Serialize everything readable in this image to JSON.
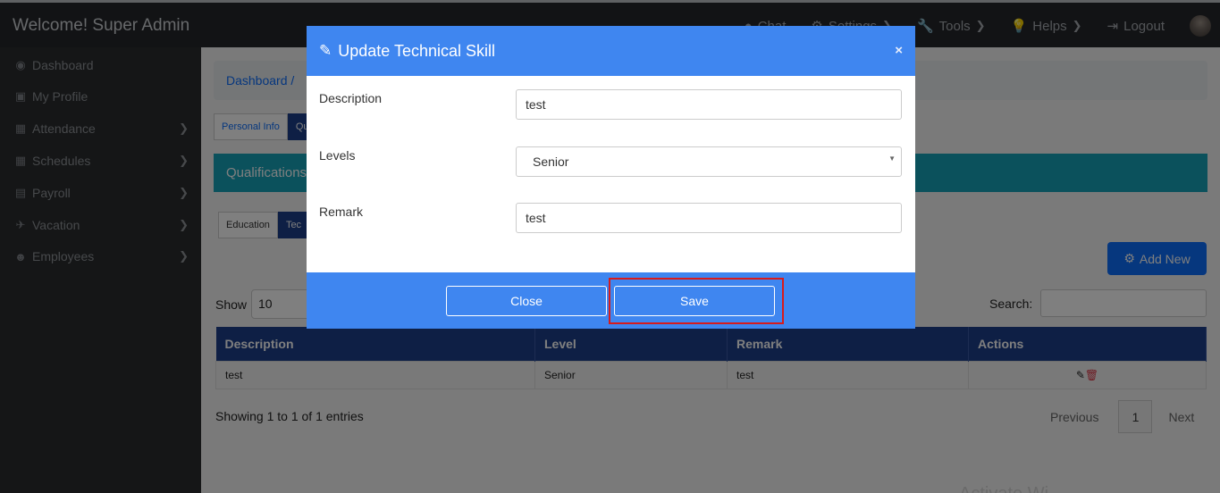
{
  "header": {
    "brand": "Welcome! Super Admin",
    "nav": [
      {
        "label": "Chat",
        "icon": "chat-icon"
      },
      {
        "label": "Settings",
        "icon": "gear-icon"
      },
      {
        "label": "Tools",
        "icon": "wrench-icon"
      },
      {
        "label": "Helps",
        "icon": "lightbulb-icon"
      },
      {
        "label": "Logout",
        "icon": "logout-icon"
      }
    ]
  },
  "sidebar": {
    "items": [
      {
        "label": "Dashboard",
        "icon": "dashboard-icon"
      },
      {
        "label": "My Profile",
        "icon": "profile-icon"
      },
      {
        "label": "Attendance",
        "icon": "calendar-icon"
      },
      {
        "label": "Schedules",
        "icon": "schedule-icon"
      },
      {
        "label": "Payroll",
        "icon": "payroll-icon"
      },
      {
        "label": "Vacation",
        "icon": "plane-icon"
      },
      {
        "label": "Employees",
        "icon": "users-icon"
      }
    ]
  },
  "page": {
    "breadcrumb": "Dashboard  /",
    "tabs": [
      "Personal Info",
      "Qu"
    ],
    "qual_title": "Qualifications",
    "subtabs": [
      "Education",
      "Tec"
    ],
    "add_new": "Add New",
    "show_label": "Show",
    "show_value": "10",
    "search_label": "Search:",
    "table": {
      "headers": [
        "Description",
        "Level",
        "Remark",
        "Actions"
      ],
      "rows": [
        [
          "test",
          "Senior",
          "test"
        ]
      ]
    },
    "info": "Showing 1 to 1 of 1 entries",
    "previous": "Previous",
    "page_num": "1",
    "next": "Next",
    "watermark": "Activate Wi"
  },
  "modal": {
    "title": "Update Technical Skill",
    "close_x": "×",
    "description_label": "Description",
    "description_value": "test",
    "levels_label": "Levels",
    "levels_value": "Senior",
    "remark_label": "Remark",
    "remark_value": "test",
    "close_button": "Close",
    "save_button": "Save"
  },
  "colors": {
    "modal_header": "#3f86f0",
    "primary": "#0d6efd",
    "table_header": "#1d3f8a",
    "teal_bar": "#17a2b8",
    "highlight": "#d81b1b"
  }
}
